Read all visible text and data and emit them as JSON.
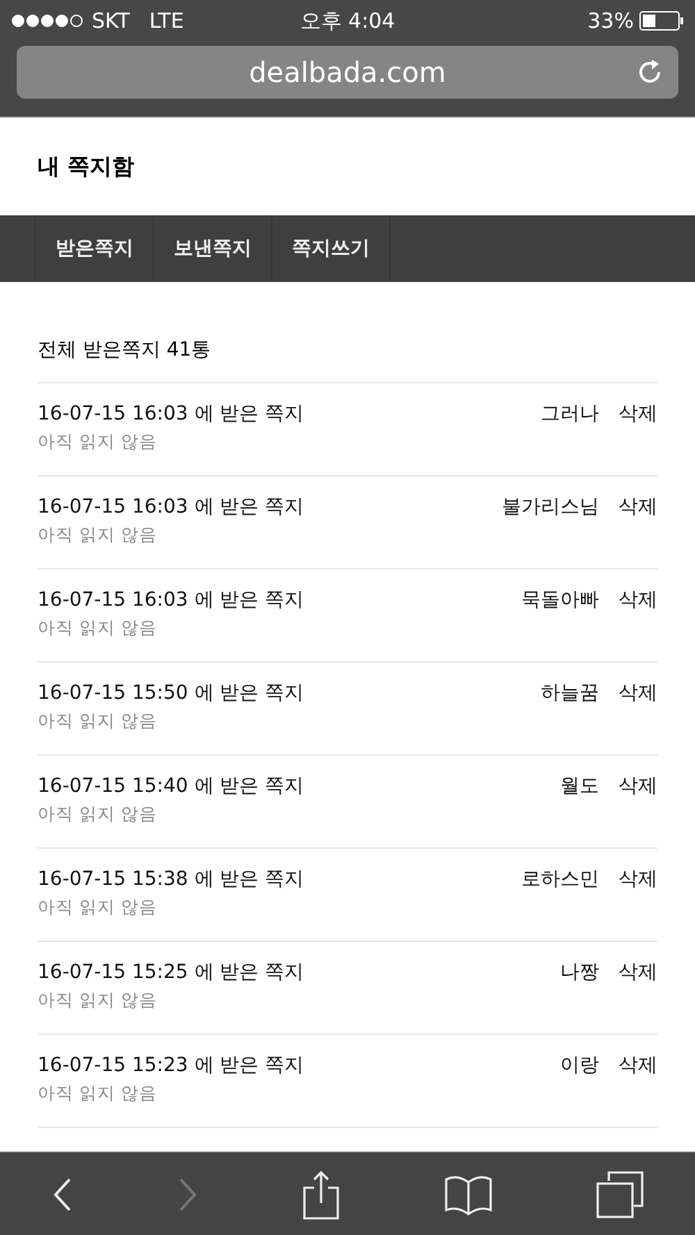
{
  "status_bar": {
    "carrier": "SKT",
    "network": "LTE",
    "time": "오후 4:04",
    "battery": "33%"
  },
  "address_bar": {
    "url": "dealbada.com"
  },
  "page_title": "내 쪽지함",
  "tabs": [
    {
      "label": "받은쪽지"
    },
    {
      "label": "보낸쪽지"
    },
    {
      "label": "쪽지쓰기"
    }
  ],
  "summary": "전체 받은쪽지 41통",
  "messages": [
    {
      "received": "16-07-15 16:03 에 받은 쪽지",
      "status": "아직 읽지 않음",
      "sender": "그러나",
      "action": "삭제"
    },
    {
      "received": "16-07-15 16:03 에 받은 쪽지",
      "status": "아직 읽지 않음",
      "sender": "불가리스님",
      "action": "삭제"
    },
    {
      "received": "16-07-15 16:03 에 받은 쪽지",
      "status": "아직 읽지 않음",
      "sender": "묵돌아빠",
      "action": "삭제"
    },
    {
      "received": "16-07-15 15:50 에 받은 쪽지",
      "status": "아직 읽지 않음",
      "sender": "하늘꿈",
      "action": "삭제"
    },
    {
      "received": "16-07-15 15:40 에 받은 쪽지",
      "status": "아직 읽지 않음",
      "sender": "월도",
      "action": "삭제"
    },
    {
      "received": "16-07-15 15:38 에 받은 쪽지",
      "status": "아직 읽지 않음",
      "sender": "로하스민",
      "action": "삭제"
    },
    {
      "received": "16-07-15 15:25 에 받은 쪽지",
      "status": "아직 읽지 않음",
      "sender": "나짱",
      "action": "삭제"
    },
    {
      "received": "16-07-15 15:23 에 받은 쪽지",
      "status": "아직 읽지 않음",
      "sender": "이랑",
      "action": "삭제"
    }
  ],
  "toolbar": [
    {
      "kind": "back",
      "disabled": false
    },
    {
      "kind": "forward",
      "disabled": true
    },
    {
      "kind": "share",
      "disabled": false
    },
    {
      "kind": "bookmarks",
      "disabled": false
    },
    {
      "kind": "tabs",
      "disabled": false
    }
  ]
}
